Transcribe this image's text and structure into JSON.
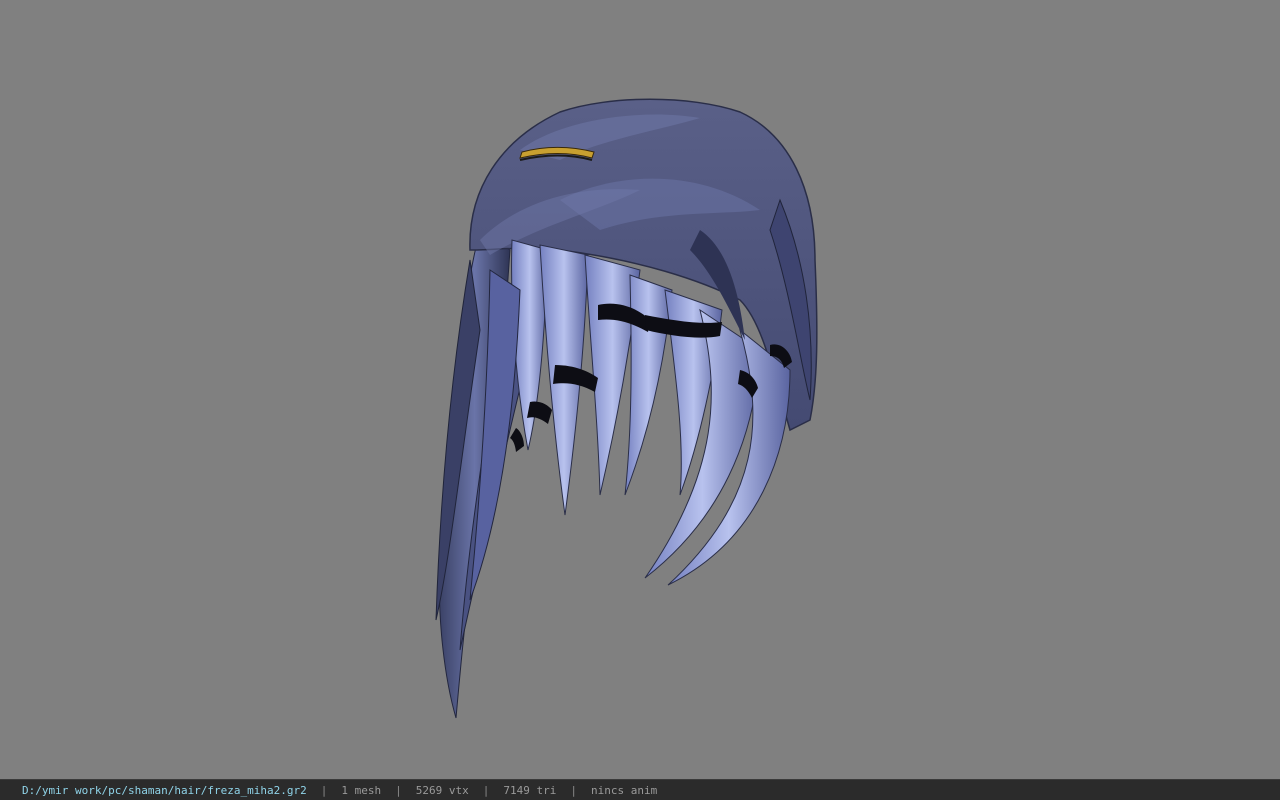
{
  "viewer": {
    "background_color": "#808080",
    "model": {
      "subject": "hair mesh",
      "base_color": "#4d5580",
      "highlight_color": "#aab4e6",
      "band_color": "#0d0d14",
      "accent_color": "#c8a030"
    }
  },
  "status_bar": {
    "file_path": "D:/ymir work/pc/shaman/hair/freza_miha2.gr2",
    "separator": "|",
    "mesh_count": "1 mesh",
    "vertex_count": "5269 vtx",
    "triangle_count": "7149 tri",
    "anim_status": "nincs anim"
  }
}
